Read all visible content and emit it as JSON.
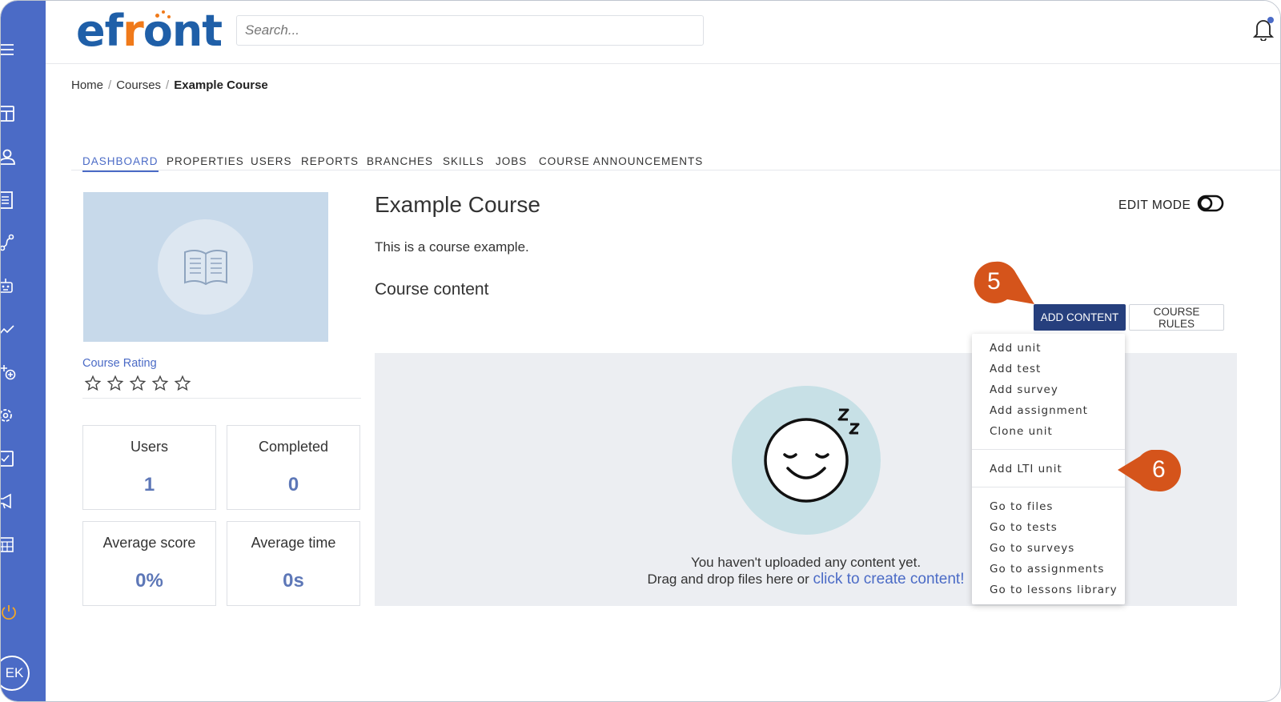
{
  "app": {
    "logo_text": "efront",
    "colors": {
      "sidebar": "#4b6bc6",
      "primary_button": "#263f7d",
      "accent": "#4b6bc6",
      "callout": "#d5541b",
      "logo_blue": "#1f5fa8",
      "logo_orange": "#f07a1a"
    }
  },
  "sidebar": {
    "icons": [
      "menu-icon",
      "dashboard-icon",
      "users-icon",
      "courses-icon",
      "paths-icon",
      "robot-icon",
      "reports-icon",
      "add-icon",
      "settings-icon",
      "assignments-icon",
      "announcements-icon",
      "calendar-icon",
      "power-icon"
    ],
    "avatar_initials": "EK"
  },
  "header": {
    "search_placeholder": "Search...",
    "notification_icon": "bell-icon"
  },
  "breadcrumb": {
    "items": [
      "Home",
      "Courses"
    ],
    "current": "Example Course",
    "separator": "/"
  },
  "tabs": [
    {
      "label": "DASHBOARD",
      "active": true
    },
    {
      "label": "PROPERTIES"
    },
    {
      "label": "USERS"
    },
    {
      "label": "REPORTS"
    },
    {
      "label": "BRANCHES"
    },
    {
      "label": "SKILLS"
    },
    {
      "label": "JOBS"
    },
    {
      "label": "COURSE ANNOUNCEMENTS"
    }
  ],
  "course": {
    "title": "Example Course",
    "description": "This is a course example.",
    "content_heading": "Course content",
    "rating_label": "Course Rating",
    "rating_stars_filled": 0,
    "rating_stars_total": 5
  },
  "stats": [
    {
      "label": "Users",
      "value": "1"
    },
    {
      "label": "Completed",
      "value": "0"
    },
    {
      "label": "Average score",
      "value": "0%"
    },
    {
      "label": "Average time",
      "value": "0s"
    }
  ],
  "toolbar": {
    "edit_mode_label": "EDIT MODE",
    "add_content_label": "ADD CONTENT",
    "course_rules_label": "COURSE RULES"
  },
  "dropdown": {
    "group1": [
      "Add unit",
      "Add test",
      "Add survey",
      "Add assignment",
      "Clone unit"
    ],
    "group2": [
      "Add LTI unit"
    ],
    "group3": [
      "Go to files",
      "Go to tests",
      "Go to surveys",
      "Go to assignments",
      "Go to lessons library"
    ]
  },
  "empty_state": {
    "line1": "You haven't uploaded any content yet.",
    "line2_prefix": "Drag and drop files here or ",
    "line2_link": "click to create content!"
  },
  "callouts": [
    "5",
    "6"
  ]
}
